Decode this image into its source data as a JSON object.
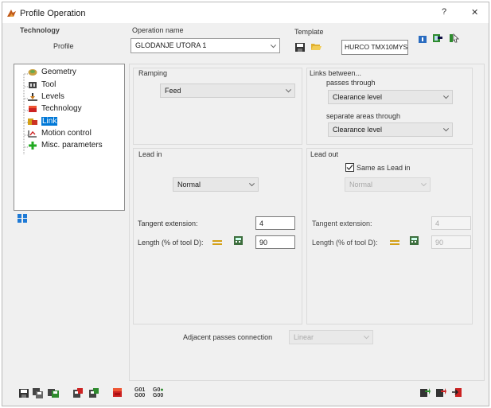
{
  "window": {
    "title": "Profile Operation",
    "help_label": "?",
    "close_label": "✕"
  },
  "header": {
    "technology_label": "Technology",
    "technology_value": "Profile",
    "operation_name_label": "Operation name",
    "operation_name_value": "GLODANJE UTORA 1",
    "template_label": "Template",
    "template_value": "HURCO TMX10MYS"
  },
  "tree": {
    "items": [
      {
        "label": "Geometry",
        "icon": "geometry-icon",
        "color": "#8b6a2a"
      },
      {
        "label": "Tool",
        "icon": "tool-icon",
        "color": "#333333"
      },
      {
        "label": "Levels",
        "icon": "levels-icon",
        "color": "#8b6a2a"
      },
      {
        "label": "Technology",
        "icon": "technology-icon",
        "color": "#cc2222"
      },
      {
        "label": "Link",
        "icon": "link-icon",
        "color": "#d4a017",
        "selected": true
      },
      {
        "label": "Motion control",
        "icon": "motion-control-icon",
        "color": "#cc2222"
      },
      {
        "label": "Misc. parameters",
        "icon": "plus-icon",
        "color": "#22aa22"
      }
    ]
  },
  "ramping": {
    "label": "Ramping",
    "value": "Feed"
  },
  "links": {
    "label": "Links between...",
    "passes_label": "passes through",
    "passes_value": "Clearance level",
    "areas_label": "separate areas through",
    "areas_value": "Clearance level"
  },
  "lead_in": {
    "label": "Lead in",
    "type_value": "Normal",
    "tangent_label": "Tangent  extension:",
    "tangent_value": "4",
    "length_label": "Length (% of tool D):",
    "length_value": "90"
  },
  "lead_out": {
    "label": "Lead out",
    "same_as_label": "Same as Lead in",
    "same_as_checked": true,
    "type_value": "Normal",
    "tangent_label": "Tangent  extension:",
    "tangent_value": "4",
    "length_label": "Length  (% of tool D):",
    "length_value": "90"
  },
  "adjacent": {
    "label": "Adjacent passes connection",
    "value": "Linear"
  },
  "bottom_toolbar": {
    "gcode_top": "G01",
    "gcode_bottom": "G00",
    "gcode2_top": "G0",
    "gcode2_bottom": "G00"
  },
  "colors": {
    "accent": "#0078d7",
    "window_bg": "#f0f0f0",
    "panel_border": "#dadada"
  }
}
